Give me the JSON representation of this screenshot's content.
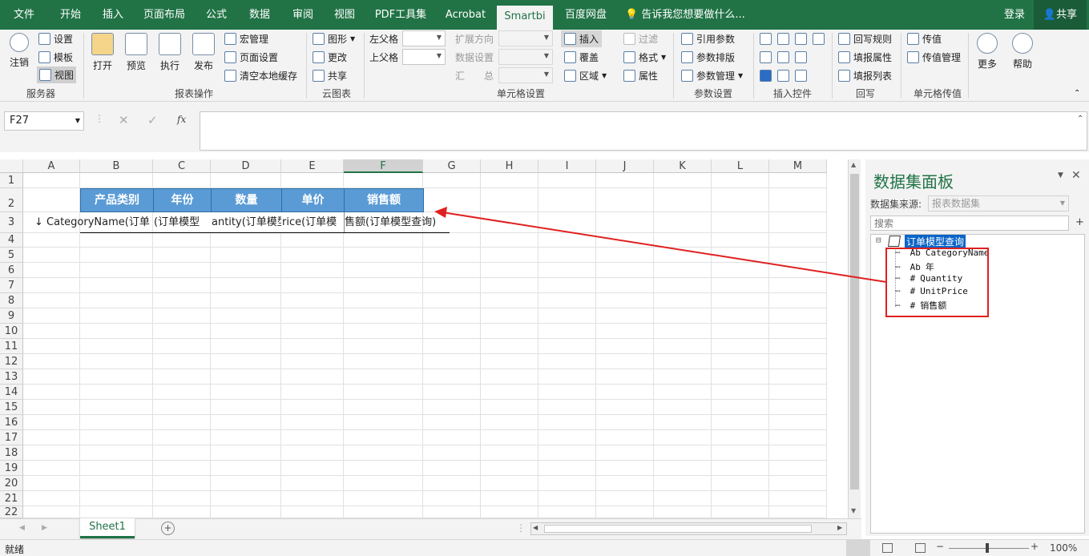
{
  "menu": {
    "tabs": [
      "文件",
      "开始",
      "插入",
      "页面布局",
      "公式",
      "数据",
      "审阅",
      "视图",
      "PDF工具集",
      "Acrobat",
      "Smartbi",
      "百度网盘"
    ],
    "active_tab": "Smartbi",
    "tell_me": "告诉我您想要做什么...",
    "login": "登录",
    "share": "共享"
  },
  "ribbon": {
    "server": {
      "logout": "注销",
      "settings": "设置",
      "template": "模板",
      "view": "视图",
      "label": "服务器"
    },
    "report": {
      "open": "打开",
      "preview": "预览",
      "execute": "执行",
      "publish": "发布",
      "macro": "宏管理",
      "page_setup": "页面设置",
      "clear_cache": "清空本地缓存",
      "label": "报表操作"
    },
    "cloud": {
      "chart": "图形",
      "update": "更改",
      "share": "共享",
      "label": "云图表"
    },
    "cell_settings": {
      "left_parent": "左父格",
      "top_parent": "上父格",
      "expand_dir": "扩展方向",
      "data_setting": "数据设置",
      "summary": "汇　　总",
      "insert": "插入",
      "overlay": "覆盖",
      "area": "区域",
      "filter": "过滤",
      "format": "格式",
      "attribute": "属性",
      "label": "单元格设置"
    },
    "params": {
      "ref": "引用参数",
      "layout": "参数排版",
      "manage": "参数管理",
      "label": "参数设置"
    },
    "controls": {
      "label": "插入控件"
    },
    "writeback": {
      "rules": "回写规则",
      "fill_attr": "填报属性",
      "fill_list": "填报列表",
      "label": "回写"
    },
    "cell_pass": {
      "pass": "传值",
      "pass_mgmt": "传值管理",
      "label": "单元格传值"
    },
    "more": "更多",
    "help": "帮助"
  },
  "formula_bar": {
    "name_box": "F27",
    "fx": "fx",
    "value": ""
  },
  "sheet": {
    "columns": [
      "A",
      "B",
      "C",
      "D",
      "E",
      "F",
      "G",
      "H",
      "I",
      "J",
      "K",
      "L",
      "M"
    ],
    "rows": [
      "1",
      "2",
      "3",
      "4",
      "5",
      "6",
      "7",
      "8",
      "9",
      "10",
      "11",
      "12",
      "13",
      "14",
      "15",
      "16",
      "17",
      "18",
      "19",
      "20",
      "21",
      "22"
    ],
    "headers": [
      "产品类别",
      "年份",
      "数量",
      "单价",
      "销售额"
    ],
    "row3": {
      "a": "↓ CategoryName(订单",
      "b": "",
      "c": "(订单模型",
      "d": "antity(订单模型",
      "e": "rice(订单模",
      "f": "售额(订单模型查询)"
    },
    "tab": "Sheet1"
  },
  "panel": {
    "title": "数据集面板",
    "source_label": "数据集来源:",
    "source_value": "报表数据集",
    "search_placeholder": "搜索",
    "root": "订单模型查询",
    "fields": [
      {
        "type": "Ab",
        "name": "CategoryName"
      },
      {
        "type": "Ab",
        "name": "年"
      },
      {
        "type": "#",
        "name": "Quantity"
      },
      {
        "type": "#",
        "name": "UnitPrice"
      },
      {
        "type": "#",
        "name": "销售额"
      }
    ]
  },
  "status": {
    "ready": "就绪",
    "zoom": "100%"
  },
  "colors": {
    "brand": "#217346",
    "header_fill": "#5b9bd5",
    "annotation": "#e02020"
  }
}
